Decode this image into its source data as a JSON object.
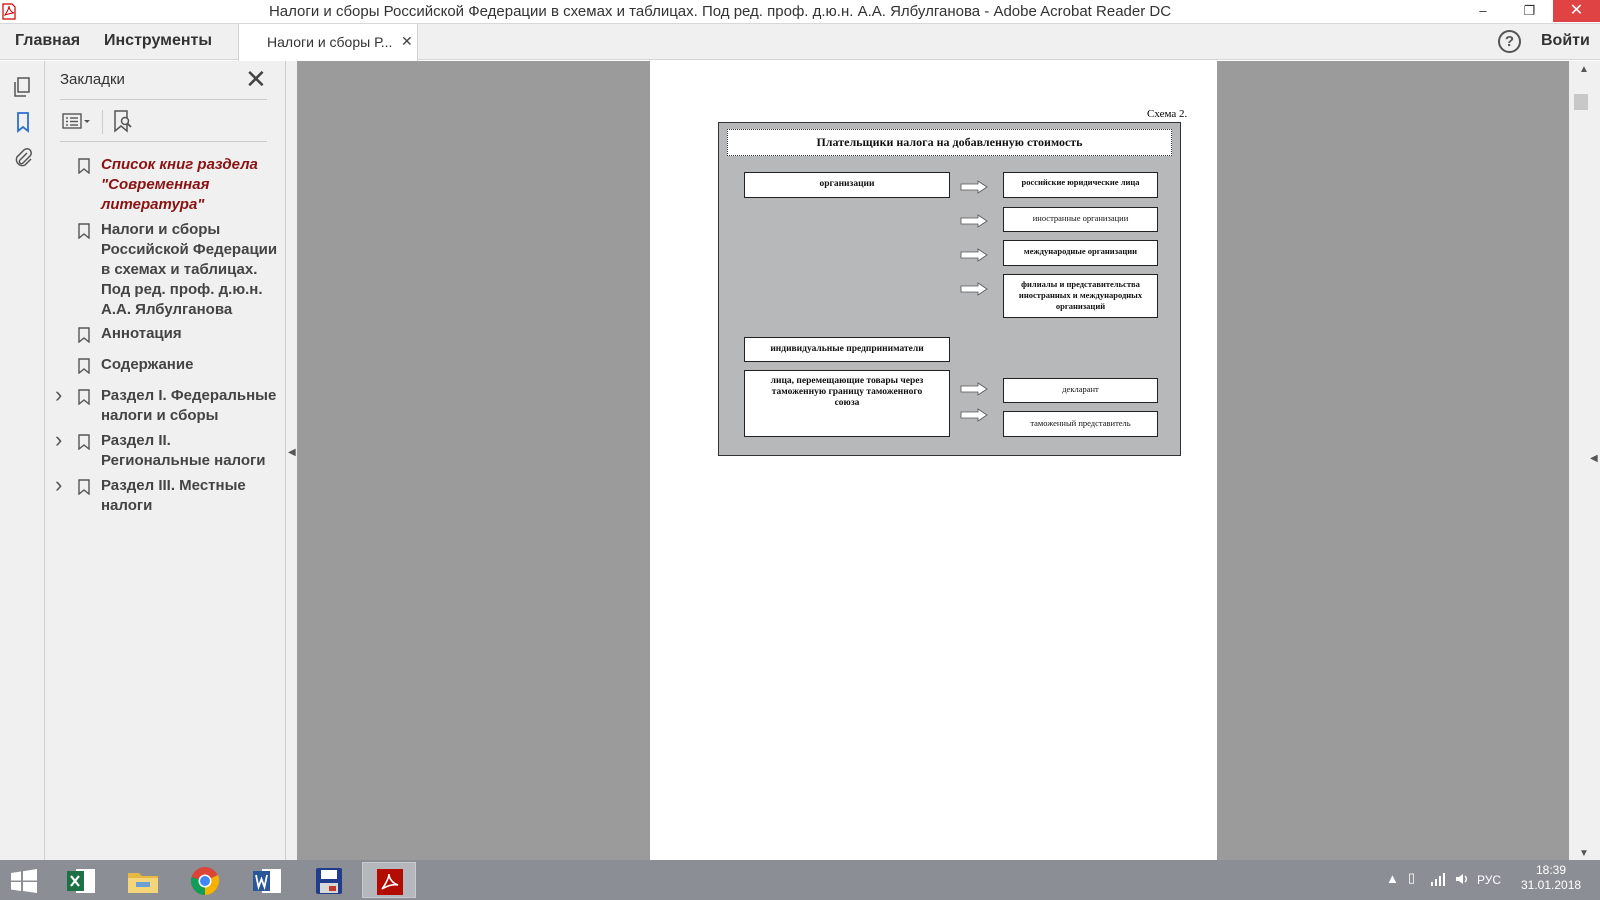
{
  "window": {
    "title": "Налоги и сборы Российской Федерации в схемах и таблицах. Под ред. проф. д.ю.н. А.А. Ялбулганова - Adobe Acrobat Reader DC",
    "minimize": "–",
    "restore": "❐",
    "close": "✕"
  },
  "menubar": {
    "home": "Главная",
    "tools": "Инструменты",
    "doc_tab": "Налоги и сборы Р...",
    "doc_tab_close": "✕",
    "help": "?",
    "signin": "Войти"
  },
  "bookmarks_panel": {
    "title": "Закладки",
    "close": "✕",
    "items": [
      {
        "label": "Список книг раздела \"Современная литература\"",
        "expandable": false
      },
      {
        "label": "Налоги и сборы Российской Федерации в схемах и таблицах. Под ред. проф. д.ю.н. А.А. Ялбулганова",
        "expandable": false
      },
      {
        "label": "Аннотация",
        "expandable": false
      },
      {
        "label": "Содержание",
        "expandable": false
      },
      {
        "label": "Раздел I. Федеральные налоги и сборы",
        "expandable": true
      },
      {
        "label": "Раздел II. Региональные налоги",
        "expandable": true
      },
      {
        "label": "Раздел III. Местные налоги",
        "expandable": true
      }
    ],
    "expand_glyph": "›"
  },
  "document": {
    "scheme_label": "Схема 2.",
    "diagram_title": "Плательщики налога на добавленную стоимость",
    "left_boxes": {
      "organizations": "организации",
      "entrepreneurs": "индивидуальные предприниматели",
      "movers": "лица, перемещающие товары через таможенную границу таможенного союза"
    },
    "right_boxes": {
      "ru_legal": "российские юридические лица",
      "foreign_orgs": "иностранные организации",
      "intl_orgs": "международные организации",
      "branches": "филиалы и представительства иностранных и международных организаций",
      "declarant": "декларант",
      "customs_rep": "таможенный представитель"
    }
  },
  "taskbar": {
    "apps": [
      "excel-icon",
      "file-explorer-icon",
      "chrome-icon",
      "word-icon",
      "save-disk-icon",
      "acrobat-icon"
    ],
    "lang": "РУС",
    "time": "18:39",
    "date": "31.01.2018"
  },
  "colors": {
    "viewer_bg": "#9b9b9b",
    "diagram_bg": "#b6b8b9",
    "taskbar_bg": "#8b8f95",
    "close_btn": "#e04343",
    "bookmark_highlight": "#8a1212",
    "active_rail_icon": "#2d6fd1"
  }
}
